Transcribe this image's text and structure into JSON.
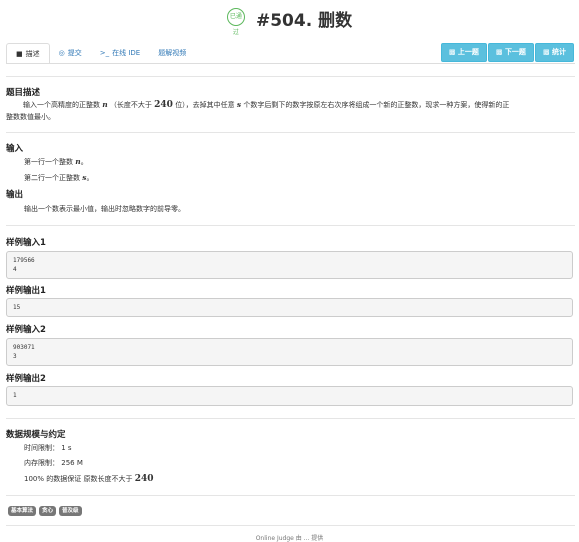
{
  "header": {
    "badge_text": "已通过",
    "title": "#504. 删数"
  },
  "tabs": [
    {
      "label": "描述",
      "icon": "book-icon"
    },
    {
      "label": "提交",
      "icon": "submit-icon"
    },
    {
      "label": "在线 IDE",
      "icon": "terminal-icon"
    },
    {
      "label": "题解视频",
      "icon": ""
    }
  ],
  "buttons": {
    "prev": "上一题",
    "next": "下一题",
    "stats": "统计"
  },
  "description": {
    "heading": "题目描述",
    "text_before_n": "输入一个高精度的正整数",
    "var_n": "n",
    "text_len_open": "（长度不大于",
    "len_limit": "240",
    "text_len_close": "位），去掉其中任意",
    "var_s": "s",
    "text_after_s": "个数字后剩下的数字按原左右次序将组成一个新的正整数，现求一种方案，使得新的正",
    "text_line2": "整数数值最小。"
  },
  "input": {
    "heading": "输入",
    "line1_prefix": "第一行一个整数",
    "line1_var": "n",
    "line1_suffix": "。",
    "line2_prefix": "第二行一个正整数",
    "line2_var": "s",
    "line2_suffix": "。"
  },
  "output": {
    "heading": "输出",
    "text": "输出一个数表示最小值，输出时忽略数字的前导零。"
  },
  "samples": [
    {
      "label": "样例输入1",
      "lines": [
        "179566",
        "4"
      ]
    },
    {
      "label": "样例输出1",
      "lines": [
        "15"
      ]
    },
    {
      "label": "样例输入2",
      "lines": [
        "903071",
        "3"
      ]
    },
    {
      "label": "样例输出2",
      "lines": [
        "1"
      ]
    }
  ],
  "constraints": {
    "heading": "数据规模与约定",
    "time_label": "时间限制：",
    "time_value": "1 s",
    "mem_label": "内存限制：",
    "mem_value": "256 M",
    "note_prefix": "100% 的数据保证 原数长度不大于",
    "note_value": "240"
  },
  "tags": [
    "基本算法",
    "贪心",
    "普及级"
  ],
  "footer": "Online Judge 由 ... 提供"
}
